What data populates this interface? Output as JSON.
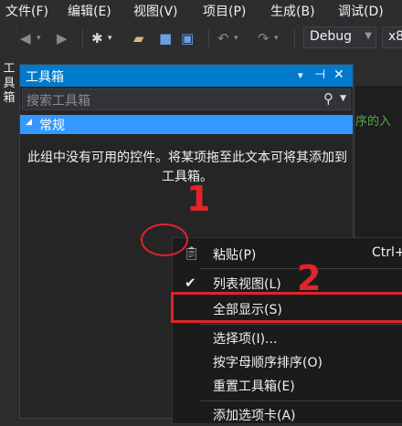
{
  "menubar": {
    "items": [
      "文件(F)",
      "编辑(E)",
      "视图(V)",
      "项目(P)",
      "生成(B)",
      "调试(D)"
    ]
  },
  "toolbar": {
    "configuration": "Debug",
    "platform": "x8"
  },
  "side_tab": {
    "label": "工具箱"
  },
  "toolbox": {
    "title": "工具箱",
    "title_buttons": [
      "▾",
      "⊣",
      "✕"
    ],
    "search_placeholder": "搜索工具箱",
    "group_label": "常规",
    "empty_message": "此组中没有可用的控件。将某项拖至此文本可将其添加到工具箱。"
  },
  "editor": {
    "visible_text": "序的入"
  },
  "context_menu": {
    "items": [
      {
        "label": "粘贴(P)",
        "shortcut": "Ctrl+",
        "icon": "paste-icon",
        "checked": false
      },
      {
        "label": "列表视图(L)",
        "shortcut": "",
        "icon": "",
        "checked": true
      },
      {
        "label": "全部显示(S)",
        "shortcut": "",
        "icon": "",
        "checked": false
      },
      {
        "label": "选择项(I)...",
        "shortcut": "",
        "icon": "",
        "checked": false
      },
      {
        "label": "按字母顺序排序(O)",
        "shortcut": "",
        "icon": "",
        "checked": false
      },
      {
        "label": "重置工具箱(E)",
        "shortcut": "",
        "icon": "",
        "checked": false
      },
      {
        "label": "添加选项卡(A)",
        "shortcut": "",
        "icon": "",
        "checked": false
      }
    ]
  },
  "annotations": {
    "step1": "1",
    "step2": "2",
    "color": "#e0242a"
  },
  "colors": {
    "accent": "#007acc",
    "group": "#3399ff",
    "background": "#2d2d30"
  }
}
